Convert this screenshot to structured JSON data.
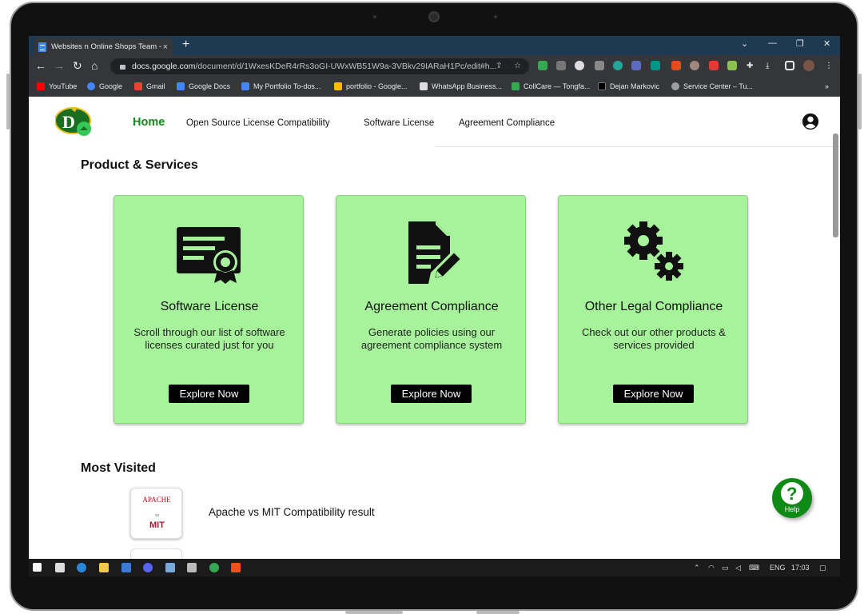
{
  "browser": {
    "tab_title": "Websites n Online Shops Team -",
    "tab_close": "×",
    "new_tab": "+",
    "url_host": "docs.google.com",
    "url_path": "/document/d/1WxesKDeR4rRs3oGI-UWxWB51W9a-3VBkv29IARaH1Pc/edit#h...",
    "bookmarks": [
      {
        "label": "YouTube",
        "color": "#ff0000"
      },
      {
        "label": "Google",
        "color": "#4285f4"
      },
      {
        "label": "Gmail",
        "color": "#ea4335"
      },
      {
        "label": "Google Docs",
        "color": "#4285f4"
      },
      {
        "label": "My Portfolio To-dos...",
        "color": "#4285f4"
      },
      {
        "label": "portfolio - Google...",
        "color": "#fbbc04"
      },
      {
        "label": "WhatsApp Business...",
        "color": "#dddddd"
      },
      {
        "label": "CollCare — Tongfa...",
        "color": "#34a853"
      },
      {
        "label": "Dejan Markovic",
        "color": "#000000"
      },
      {
        "label": "Service Center – Tu...",
        "color": "#9e9e9e"
      }
    ],
    "more_bookmarks": "»"
  },
  "site": {
    "logo_letter": "D",
    "nav": {
      "home": "Home",
      "open_source": "Open Source License Compatibility",
      "software_license": "Software License",
      "agreement": "Agreement Compliance"
    },
    "sections": {
      "products": "Product & Services",
      "most_visited": "Most Visited"
    },
    "cards": [
      {
        "title": "Software License",
        "desc": "Scroll through our list of software licenses curated just for you",
        "button": "Explore Now",
        "icon": "certificate-icon"
      },
      {
        "title": "Agreement Compliance",
        "desc": "Generate policies using our agreement compliance system",
        "button": "Explore Now",
        "icon": "document-edit-icon"
      },
      {
        "title": "Other Legal Compliance",
        "desc": "Check out our other products & services provided",
        "button": "Explore Now",
        "icon": "gears-icon"
      }
    ],
    "visited": [
      {
        "label": "Apache vs MIT Compatibility result",
        "thumb_top": "APACHE",
        "thumb_mid": "vs",
        "thumb_bottom": "MIT"
      }
    ],
    "help_label": "Help",
    "colors": {
      "accent_green": "#118a1b",
      "card_bg": "#a7f39b",
      "button_bg": "#000000"
    }
  },
  "taskbar": {
    "lang": "ENG",
    "time": "17:03"
  }
}
